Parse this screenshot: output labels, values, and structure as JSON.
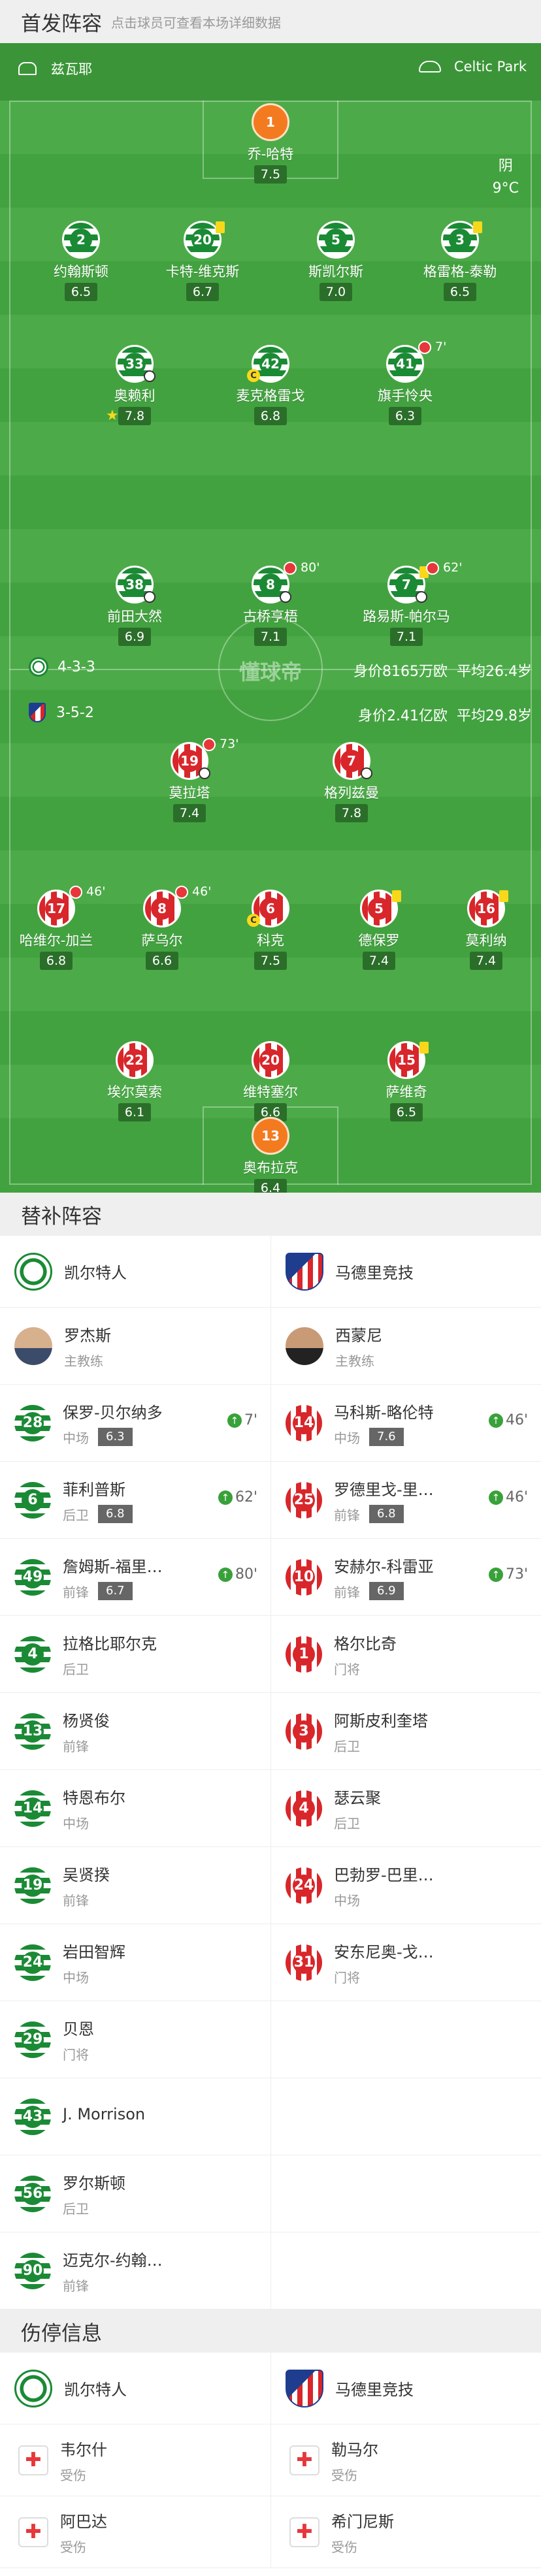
{
  "lineup": {
    "title": "首发阵容",
    "hint": "点击球员可查看本场详细数据"
  },
  "pitch": {
    "home_coach": "兹瓦耶",
    "away_label": "Celtic Park",
    "weather": "阴",
    "temp": "9°C",
    "watermark": "懂球帝"
  },
  "home": {
    "formation": "4-3-3",
    "value": "身价8165万欧",
    "age": "平均26.4岁",
    "players": [
      {
        "num": "1",
        "name": "乔-哈特",
        "rating": "7.5"
      },
      {
        "num": "2",
        "name": "约翰斯顿",
        "rating": "6.5"
      },
      {
        "num": "20",
        "name": "卡特-维克斯",
        "rating": "6.7"
      },
      {
        "num": "5",
        "name": "斯凯尔斯",
        "rating": "7.0"
      },
      {
        "num": "3",
        "name": "格雷格-泰勒",
        "rating": "6.5"
      },
      {
        "num": "33",
        "name": "奥赖利",
        "rating": "7.8"
      },
      {
        "num": "42",
        "name": "麦克格雷戈",
        "rating": "6.8"
      },
      {
        "num": "41",
        "name": "旗手怜央",
        "rating": "6.3",
        "sub": "7'"
      },
      {
        "num": "38",
        "name": "前田大然",
        "rating": "6.9"
      },
      {
        "num": "8",
        "name": "古桥亨梧",
        "rating": "7.1",
        "sub": "80'"
      },
      {
        "num": "7",
        "name": "路易斯-帕尔马",
        "rating": "7.1",
        "sub": "62'"
      }
    ]
  },
  "away": {
    "formation": "3-5-2",
    "value": "身价2.41亿欧",
    "age": "平均29.8岁",
    "players": [
      {
        "num": "19",
        "name": "莫拉塔",
        "rating": "7.4",
        "sub": "73'"
      },
      {
        "num": "7",
        "name": "格列兹曼",
        "rating": "7.8"
      },
      {
        "num": "17",
        "name": "哈维尔-加兰",
        "rating": "6.8",
        "sub": "46'"
      },
      {
        "num": "8",
        "name": "萨乌尔",
        "rating": "6.6",
        "sub": "46'"
      },
      {
        "num": "6",
        "name": "科克",
        "rating": "7.5"
      },
      {
        "num": "5",
        "name": "德保罗",
        "rating": "7.4"
      },
      {
        "num": "16",
        "name": "莫利纳",
        "rating": "7.4"
      },
      {
        "num": "22",
        "name": "埃尔莫索",
        "rating": "6.1"
      },
      {
        "num": "20",
        "name": "维特塞尔",
        "rating": "6.6"
      },
      {
        "num": "15",
        "name": "萨维奇",
        "rating": "6.5"
      },
      {
        "num": "13",
        "name": "奥布拉克",
        "rating": "6.4"
      }
    ]
  },
  "subs": {
    "title": "替补阵容",
    "home_team": "凯尔特人",
    "away_team": "马德里竞技",
    "home_coach": {
      "name": "罗杰斯",
      "role": "主教练"
    },
    "away_coach": {
      "name": "西蒙尼",
      "role": "主教练"
    },
    "rows": [
      [
        {
          "num": "28",
          "name": "保罗-贝尔纳多",
          "pos": "中场",
          "rating": "6.3",
          "in": "7'"
        },
        {
          "num": "14",
          "name": "马科斯-略伦特",
          "pos": "中场",
          "rating": "7.6",
          "in": "46'"
        }
      ],
      [
        {
          "num": "6",
          "name": "菲利普斯",
          "pos": "后卫",
          "rating": "6.8",
          "in": "62'"
        },
        {
          "num": "25",
          "name": "罗德里戈-里…",
          "pos": "前锋",
          "rating": "6.8",
          "in": "46'"
        }
      ],
      [
        {
          "num": "49",
          "name": "詹姆斯-福里…",
          "pos": "前锋",
          "rating": "6.7",
          "in": "80'"
        },
        {
          "num": "10",
          "name": "安赫尔-科雷亚",
          "pos": "前锋",
          "rating": "6.9",
          "in": "73'"
        }
      ],
      [
        {
          "num": "4",
          "name": "拉格比耶尔克",
          "pos": "后卫"
        },
        {
          "num": "1",
          "name": "格尔比奇",
          "pos": "门将"
        }
      ],
      [
        {
          "num": "13",
          "name": "杨贤俊",
          "pos": "前锋"
        },
        {
          "num": "3",
          "name": "阿斯皮利奎塔",
          "pos": "后卫"
        }
      ],
      [
        {
          "num": "14",
          "name": "特恩布尔",
          "pos": "中场"
        },
        {
          "num": "4",
          "name": "瑟云聚",
          "pos": "后卫"
        }
      ],
      [
        {
          "num": "19",
          "name": "吴贤揆",
          "pos": "前锋"
        },
        {
          "num": "24",
          "name": "巴勃罗-巴里…",
          "pos": "中场"
        }
      ],
      [
        {
          "num": "24",
          "name": "岩田智辉",
          "pos": "中场"
        },
        {
          "num": "31",
          "name": "安东尼奥-戈…",
          "pos": "门将"
        }
      ],
      [
        {
          "num": "29",
          "name": "贝恩",
          "pos": "门将"
        },
        null
      ],
      [
        {
          "num": "43",
          "name": "J. Morrison",
          "pos": ""
        },
        null
      ],
      [
        {
          "num": "56",
          "name": "罗尔斯顿",
          "pos": "后卫"
        },
        null
      ],
      [
        {
          "num": "90",
          "name": "迈克尔-约翰…",
          "pos": "前锋"
        },
        null
      ]
    ]
  },
  "injuries": {
    "title": "伤停信息",
    "home_team": "凯尔特人",
    "away_team": "马德里竞技",
    "rows": [
      [
        {
          "name": "韦尔什",
          "status": "受伤"
        },
        {
          "name": "勒马尔",
          "status": "受伤"
        }
      ],
      [
        {
          "name": "阿巴达",
          "status": "受伤"
        },
        {
          "name": "希门尼斯",
          "status": "受伤"
        }
      ]
    ]
  }
}
